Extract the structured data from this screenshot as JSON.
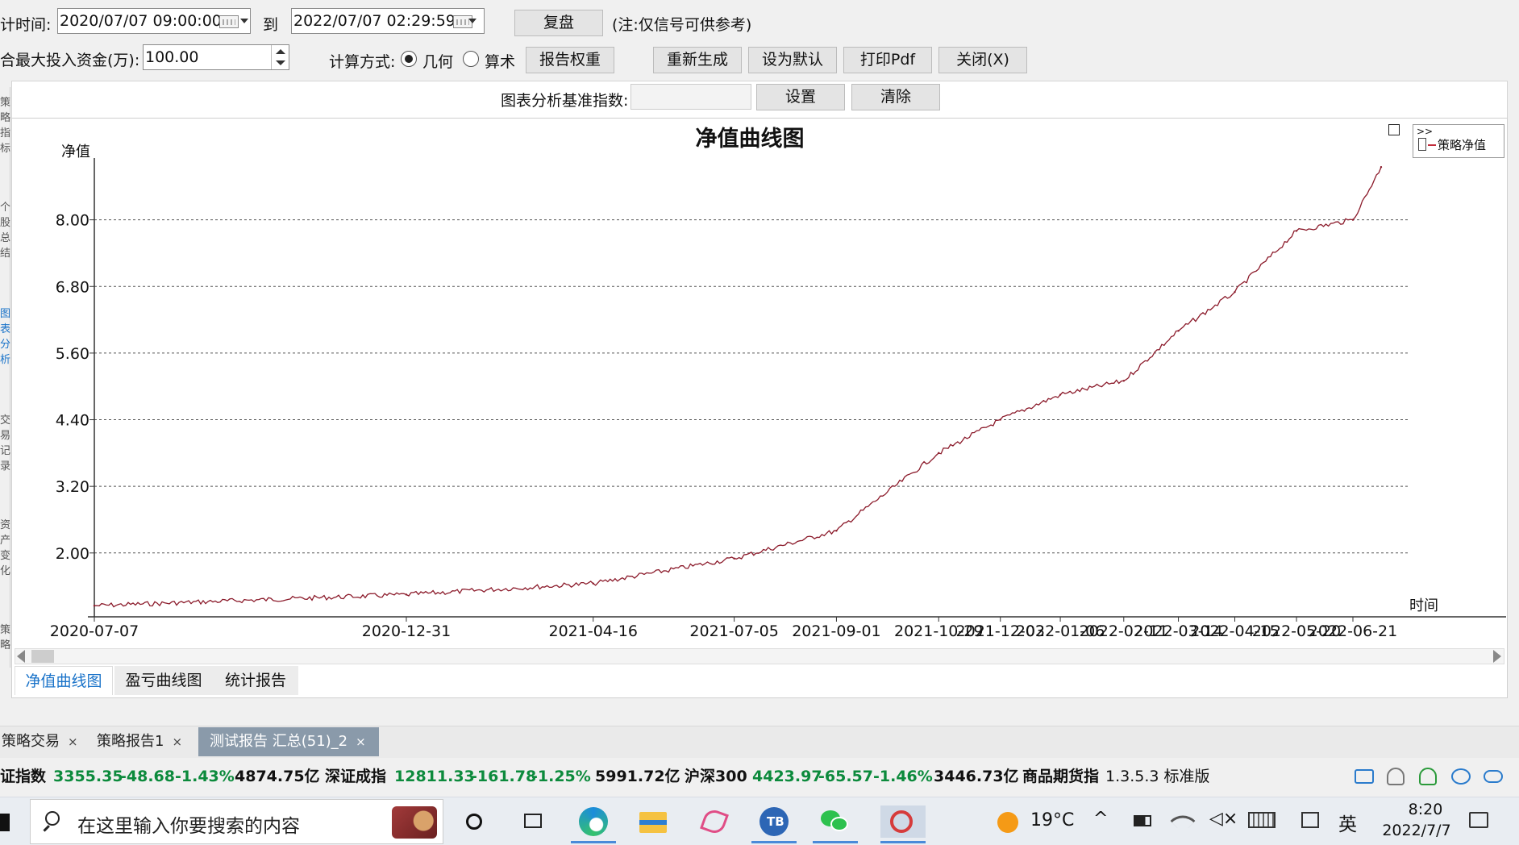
{
  "toolbar": {
    "time_label": "计时间:",
    "start_time": "2020/07/07 09:00:00",
    "to_label": "到",
    "end_time": "2022/07/07 02:29:59",
    "replay_button": "复盘",
    "note": "(注:仅信号可供参考)",
    "max_capital_label": "合最大投入资金(万):",
    "max_capital_value": "100.00",
    "calc_label": "计算方式:",
    "calc_options": [
      "几何",
      "算术"
    ],
    "calc_selected": "几何",
    "report_weight_button": "报告权重",
    "regenerate_button": "重新生成",
    "set_default_button": "设为默认",
    "print_pdf_button": "打印Pdf",
    "close_button": "关闭(X)",
    "benchmark_label": "图表分析基准指数:",
    "benchmark_value": "",
    "set_button": "设置",
    "clear_button": "清除"
  },
  "sidebar": {
    "items": [
      "策略指标",
      "个股总结",
      "图表分析",
      "交易记录",
      "资产变化",
      "策略"
    ]
  },
  "chart_tabs": [
    "净值曲线图",
    "盈亏曲线图",
    "统计报告"
  ],
  "chart_tab_active": "净值曲线图",
  "bottom_tabs": [
    {
      "label": "策略交易",
      "close": "×"
    },
    {
      "label": "策略报告1",
      "close": "×"
    },
    {
      "label": "测试报告 汇总(51)_2",
      "close": "×"
    }
  ],
  "ticker": {
    "items": [
      {
        "name": "证指数",
        "price": "3355.35",
        "change": "-48.68",
        "pct": "-1.43%",
        "amount": "4874.75亿"
      },
      {
        "name": "深证成指",
        "price": "12811.33",
        "change": "-161.78",
        "pct": "-1.25%",
        "amount": "5991.72亿"
      },
      {
        "name": "沪深300",
        "price": "4423.97",
        "change": "-65.57",
        "pct": "-1.46%",
        "amount": "3446.73亿"
      }
    ],
    "futures_label": "商品期货指",
    "version": "1.3.5.3 标准版"
  },
  "taskbar": {
    "search_placeholder": "在这里输入你要搜索的内容",
    "weather": "19°C",
    "ime": "英",
    "time": "8:20",
    "date": "2022/7/7"
  },
  "colors": {
    "series": "#8b1a2a",
    "accent": "#1a73c9",
    "ticker_green": "#0c8a3c"
  },
  "chart_data": {
    "type": "line",
    "title": "净值曲线图",
    "ylabel": "净值",
    "xlabel": "时间",
    "legend": {
      "label": "策略净值",
      "position": "top-right"
    },
    "ylim": [
      0.85,
      9.2
    ],
    "yticks": [
      "8.00",
      "6.80",
      "5.60",
      "4.40",
      "3.20",
      "2.00"
    ],
    "ytick_values": [
      8.0,
      6.8,
      5.6,
      4.4,
      3.2,
      2.0
    ],
    "grid": true,
    "xticks": [
      "2020-07-07",
      "2020-12-31",
      "2021-04-16",
      "2021-07-05",
      "2021-09-01",
      "2021-10-29",
      "2021-12-03",
      "2022-01-06",
      "2022-02-11",
      "2022-03-14",
      "2022-04-15",
      "2022-05-20",
      "2022-06-21"
    ],
    "series": [
      {
        "name": "策略净值",
        "x": [
          "2020-07-07",
          "2020-12-31",
          "2021-04-16",
          "2021-07-05",
          "2021-09-01",
          "2021-10-29",
          "2021-12-03",
          "2022-01-06",
          "2022-02-11",
          "2022-03-14",
          "2022-04-15",
          "2022-05-20",
          "2022-06-21",
          "2022-07-07"
        ],
        "values": [
          1.05,
          1.25,
          1.45,
          1.9,
          2.4,
          3.8,
          4.4,
          4.85,
          5.1,
          6.0,
          6.7,
          7.8,
          8.0,
          8.95
        ]
      }
    ]
  }
}
